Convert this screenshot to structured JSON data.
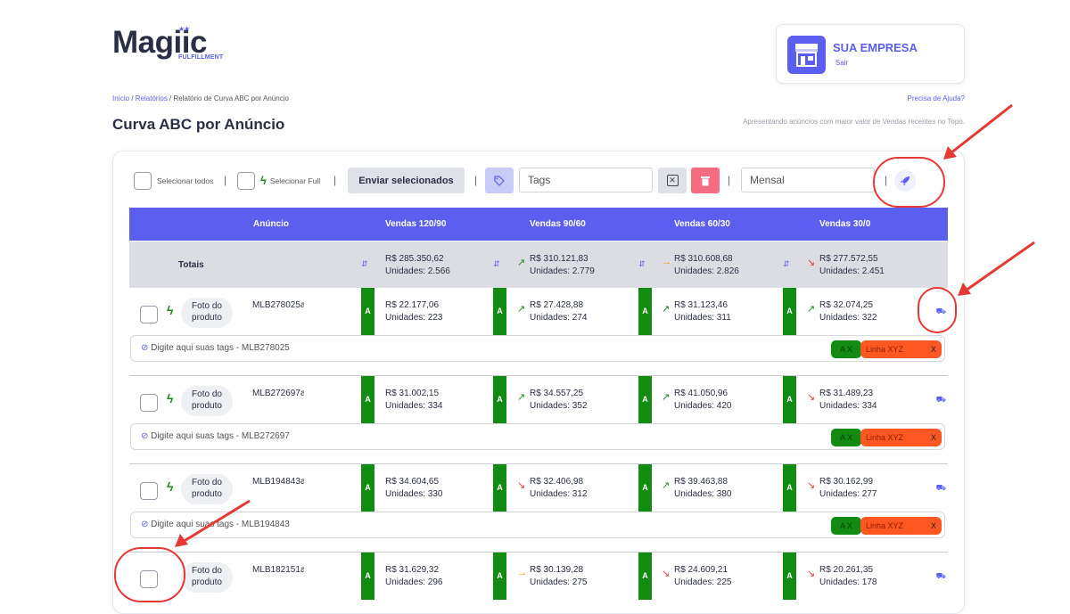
{
  "brand": {
    "name": "Magiic",
    "sub": "FULFILLMENT",
    "stars": "★★"
  },
  "company": {
    "name": "SUA EMPRESA",
    "logout": "Sair"
  },
  "breadcrumb": {
    "home": "Início",
    "reports": "Relatórios",
    "current": "Relatório de Curva ABC por Anúncio"
  },
  "help_link": "Precisa de Ajuda?",
  "page_title": "Curva ABC por Anúncio",
  "page_subtitle": "Apresentando anúncios com maior valor de Vendas recentes no Topo.",
  "toolbar": {
    "select_all": "Selecionar todos",
    "select_full": "Selecionar Full",
    "send_selected": "Enviar selecionados",
    "tags_placeholder": "Tags",
    "period_value": "Mensal",
    "sep": "|"
  },
  "table": {
    "headers": [
      "Anúncio",
      "Vendas 120/90",
      "Vendas 90/60",
      "Vendas 60/30",
      "Vendas 30/0"
    ],
    "totals_label": "Totais",
    "totals": [
      {
        "value": "R$ 285.350,62",
        "units": "Unidades: 2.566",
        "trend": ""
      },
      {
        "value": "R$ 310.121,83",
        "units": "Unidades: 2.779",
        "trend": "up"
      },
      {
        "value": "R$ 310.608,68",
        "units": "Unidades: 2.826",
        "trend": "right"
      },
      {
        "value": "R$ 277.572,55",
        "units": "Unidades: 2.451",
        "trend": "down"
      }
    ],
    "photo_label": "Foto do produto",
    "abc_class": "A",
    "tag_placeholder_prefix": "Digite aqui suas tags - ",
    "tag_chip_a": "A X",
    "tag_chip_line": "Linha XYZ",
    "tag_chip_x": "X",
    "rows": [
      {
        "mlb": "MLB278025",
        "status": "active",
        "full": true,
        "cells": [
          {
            "value": "R$ 22.177,06",
            "units": "Unidades: 223",
            "trend": ""
          },
          {
            "value": "R$ 27.428,88",
            "units": "Unidades: 274",
            "trend": "up"
          },
          {
            "value": "R$ 31.123,46",
            "units": "Unidades: 311",
            "trend": "up"
          },
          {
            "value": "R$ 32.074,25",
            "units": "Unidades: 322",
            "trend": "up"
          }
        ]
      },
      {
        "mlb": "MLB272697",
        "status": "active",
        "full": true,
        "cells": [
          {
            "value": "R$ 31.002,15",
            "units": "Unidades: 334",
            "trend": ""
          },
          {
            "value": "R$ 34.557,25",
            "units": "Unidades: 352",
            "trend": "up"
          },
          {
            "value": "R$ 41.050,96",
            "units": "Unidades: 420",
            "trend": "up"
          },
          {
            "value": "R$ 31.489,23",
            "units": "Unidades: 334",
            "trend": "down"
          }
        ]
      },
      {
        "mlb": "MLB194843",
        "status": "active",
        "full": true,
        "cells": [
          {
            "value": "R$ 34.604,65",
            "units": "Unidades: 330",
            "trend": ""
          },
          {
            "value": "R$ 32.406,98",
            "units": "Unidades: 312",
            "trend": "down"
          },
          {
            "value": "R$ 39.463,88",
            "units": "Unidades: 380",
            "trend": "up"
          },
          {
            "value": "R$ 30.162,99",
            "units": "Unidades: 277",
            "trend": "down"
          }
        ]
      },
      {
        "mlb": "MLB182151",
        "status": "active",
        "full": false,
        "cells": [
          {
            "value": "R$ 31.629,32",
            "units": "Unidades: 296",
            "trend": ""
          },
          {
            "value": "R$ 30.139,28",
            "units": "Unidades: 275",
            "trend": "right"
          },
          {
            "value": "R$ 24.609,21",
            "units": "Unidades: 225",
            "trend": "down"
          },
          {
            "value": "R$ 20.261,35",
            "units": "Unidades: 178",
            "trend": "down"
          }
        ]
      }
    ]
  },
  "colors": {
    "accent": "#5b5ff0",
    "abc_green": "#118b11",
    "tag_orange": "#ff5722",
    "annotation_red": "#e53935"
  },
  "icons": {
    "full": "bolt-icon",
    "trend_up": "arrow-up-right-icon",
    "trend_down": "arrow-down-right-icon",
    "trend_flat": "arrow-right-icon",
    "sort": "sort-icon",
    "ship": "truck-icon",
    "rocket": "rocket-icon",
    "tag": "tag-icon",
    "trash": "trash-icon",
    "clear": "close-box-icon",
    "store": "store-icon"
  }
}
